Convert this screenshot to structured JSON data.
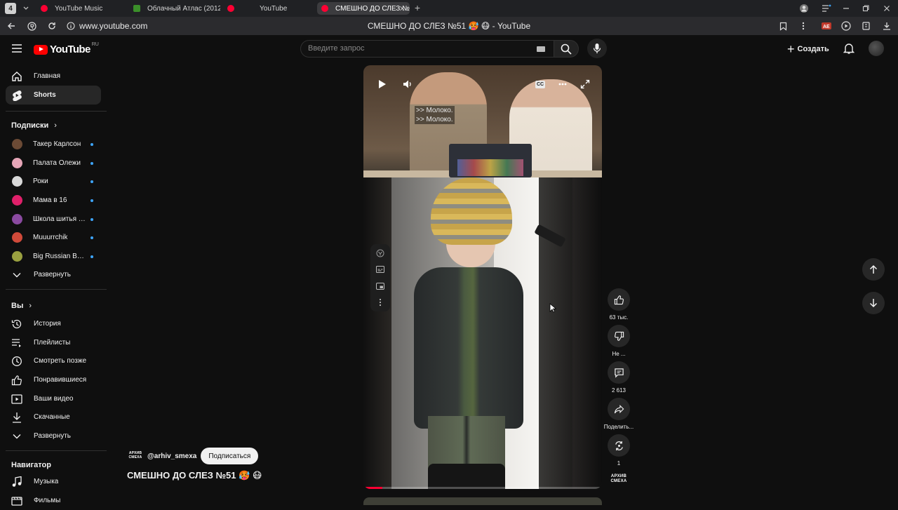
{
  "browser": {
    "tab_count": "4",
    "tabs": [
      {
        "title": "YouTube Music"
      },
      {
        "title": "Облачный Атлас (2012) С"
      },
      {
        "title": "YouTube"
      },
      {
        "title": "СМЕШНО ДО СЛЕЗ №"
      }
    ],
    "url": "www.youtube.com",
    "window_title": "СМЕШНО ДО СЛЕЗ №51 🥵 😷 - YouTube"
  },
  "masthead": {
    "logo_text": "YouTube",
    "region": "RU",
    "search_placeholder": "Введите запрос",
    "create_label": "Создать"
  },
  "sidebar": {
    "main": [
      {
        "label": "Главная",
        "icon": "home-icon"
      },
      {
        "label": "Shorts",
        "icon": "shorts-icon",
        "active": true
      }
    ],
    "subscriptions_heading": "Подписки",
    "subscriptions": [
      {
        "label": "Такер Карлсон",
        "color": "#6b4a35"
      },
      {
        "label": "Палата Олежи",
        "color": "#e6a6b8"
      },
      {
        "label": "Роки",
        "color": "#d8d8d8"
      },
      {
        "label": "Мама в 16",
        "color": "#e0206a"
      },
      {
        "label": "Школа шитья Х...",
        "color": "#8a4aa0"
      },
      {
        "label": "Muuurrchik",
        "color": "#d04a3a"
      },
      {
        "label": "Big Russian Bos...",
        "color": "#9aa040"
      }
    ],
    "subscriptions_expand": "Развернуть",
    "you_heading": "Вы",
    "you_items": [
      {
        "label": "История",
        "icon": "history-icon"
      },
      {
        "label": "Плейлисты",
        "icon": "playlists-icon"
      },
      {
        "label": "Смотреть позже",
        "icon": "watch-later-icon"
      },
      {
        "label": "Понравившиеся",
        "icon": "like-icon"
      },
      {
        "label": "Ваши видео",
        "icon": "your-videos-icon"
      },
      {
        "label": "Скачанные",
        "icon": "download-icon"
      }
    ],
    "you_expand": "Развернуть",
    "navigator_heading": "Навигатор",
    "navigator_items": [
      {
        "label": "Музыка",
        "icon": "music-icon"
      },
      {
        "label": "Фильмы",
        "icon": "movies-icon"
      }
    ]
  },
  "player": {
    "subtitle": ">> Молоко.\n>> Молоко.",
    "cc_label": "CC",
    "progress": 0.08
  },
  "actions": {
    "likes": "63 тыс.",
    "dislike": "Не ...",
    "comments": "2 613",
    "share": "Поделить...",
    "remix": "1"
  },
  "channel": {
    "logo_text": "АРХИВ СМЕХА",
    "handle": "@arhiv_smexa",
    "subscribe_label": "Подписаться"
  },
  "video_title": "СМЕШНО ДО СЛЕЗ №51 🥵 😷"
}
